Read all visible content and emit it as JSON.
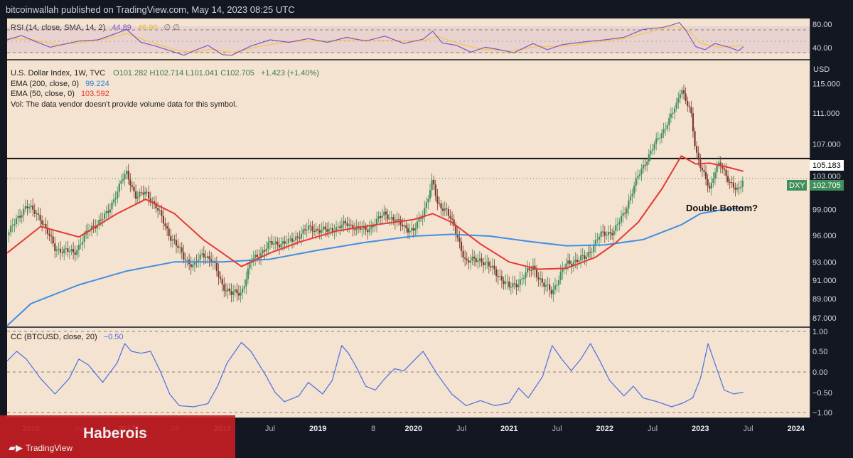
{
  "publisher": "bitcoinwallah published on TradingView.com, May 14, 2023 08:25 UTC",
  "colors": {
    "background": "#f4e3d0",
    "frame": "#131722",
    "up_candle": "#3f8f5b",
    "down_candle": "#7a3a2c",
    "ema200": "#3f8fe3",
    "ema50": "#e53935",
    "rsi_line": "#7e57c2",
    "rsi_sma": "#f2c94c",
    "corr_line": "#4a6fe3",
    "watermark": "#c21e23"
  },
  "rsi_panel": {
    "legend": {
      "name": "RSI (14, close, SMA, 14, 2)",
      "value": "44.89",
      "sma_value": "46.90",
      "extra": "∅  ∅"
    },
    "axis_labels": [
      "80.00",
      "40.00"
    ]
  },
  "main_panel": {
    "legend": {
      "symbol": "U.S. Dollar Index, 1W, TVC",
      "ohlc": "O101.282  H102.714  L101.041  C102.705",
      "change": "+1.423 (+1.40%)",
      "ema200_name": "EMA (200, close, 0)",
      "ema200_value": "99.224",
      "ema50_name": "EMA (50, close, 0)",
      "ema50_value": "103.592",
      "vol": "Vol: The data vendor doesn't provide volume data for this symbol."
    },
    "currency": "USD",
    "resistance_label": "105.183",
    "dxy_badge": {
      "symbol": "DXY",
      "value": "102.705"
    },
    "annotation": "Double Bottom?"
  },
  "cc_panel": {
    "legend": {
      "name": "CC (BTCUSD, close, 20)",
      "value": "−0.50"
    },
    "axis_labels": [
      "1.00",
      "0.50",
      "0.00",
      "−0.50",
      "−1.00"
    ]
  },
  "time_axis": [
    "2016",
    "Jul",
    "2017",
    "Jul",
    "2018",
    "Jul",
    "2019",
    "8",
    "2020",
    "Jul",
    "2021",
    "Jul",
    "2022",
    "Jul",
    "2023",
    "Jul",
    "2024"
  ],
  "watermark": {
    "text": "Haberois",
    "logo_text": "TradingView",
    "logo_icon": "tradingview-logo-icon"
  },
  "chart_data": {
    "type": "candlestick",
    "interval": "1W",
    "x_range": [
      2015.75,
      2024.15
    ],
    "price": {
      "log_scale": true,
      "ylim": [
        86.2,
        117.5
      ],
      "ticks": [
        "87.000",
        "89.000",
        "91.000",
        "93.000",
        "96.000",
        "99.000",
        "103.000",
        "107.000",
        "111.000",
        "115.000"
      ],
      "resistance": 105.183,
      "dxy_path": [
        [
          2015.75,
          96
        ],
        [
          2015.95,
          99.5
        ],
        [
          2016.1,
          98
        ],
        [
          2016.25,
          94.5
        ],
        [
          2016.45,
          94
        ],
        [
          2016.6,
          96.5
        ],
        [
          2016.8,
          98.5
        ],
        [
          2016.95,
          102.5
        ],
        [
          2017.0,
          103.3
        ],
        [
          2017.1,
          100.5
        ],
        [
          2017.2,
          101
        ],
        [
          2017.3,
          99.5
        ],
        [
          2017.45,
          96
        ],
        [
          2017.6,
          93.5
        ],
        [
          2017.7,
          92.5
        ],
        [
          2017.8,
          94
        ],
        [
          2017.9,
          93
        ],
        [
          2018.0,
          90.5
        ],
        [
          2018.1,
          89.5
        ],
        [
          2018.2,
          89.7
        ],
        [
          2018.3,
          93
        ],
        [
          2018.5,
          95
        ],
        [
          2018.7,
          95.2
        ],
        [
          2018.9,
          96.8
        ],
        [
          2019.1,
          96.5
        ],
        [
          2019.3,
          97.3
        ],
        [
          2019.5,
          96.5
        ],
        [
          2019.7,
          98.5
        ],
        [
          2019.9,
          97
        ],
        [
          2020.0,
          96.5
        ],
        [
          2020.1,
          98.5
        ],
        [
          2020.2,
          102.5
        ],
        [
          2020.25,
          99.5
        ],
        [
          2020.35,
          99
        ],
        [
          2020.45,
          96
        ],
        [
          2020.55,
          93
        ],
        [
          2020.7,
          93.3
        ],
        [
          2020.85,
          92
        ],
        [
          2021.0,
          90.2
        ],
        [
          2021.1,
          90.8
        ],
        [
          2021.25,
          92.5
        ],
        [
          2021.35,
          90.5
        ],
        [
          2021.45,
          89.8
        ],
        [
          2021.6,
          92.8
        ],
        [
          2021.8,
          93.5
        ],
        [
          2021.95,
          96
        ],
        [
          2022.1,
          96.5
        ],
        [
          2022.2,
          98.5
        ],
        [
          2022.35,
          103
        ],
        [
          2022.5,
          106.5
        ],
        [
          2022.6,
          108.5
        ],
        [
          2022.75,
          112
        ],
        [
          2022.8,
          114.5
        ],
        [
          2022.9,
          111
        ],
        [
          2022.95,
          106
        ],
        [
          2023.05,
          103
        ],
        [
          2023.1,
          101
        ],
        [
          2023.15,
          103.5
        ],
        [
          2023.2,
          105
        ],
        [
          2023.3,
          102
        ],
        [
          2023.4,
          101.5
        ],
        [
          2023.45,
          102.7
        ]
      ],
      "ema50": [
        [
          2015.75,
          94
        ],
        [
          2016.1,
          97
        ],
        [
          2016.5,
          95.8
        ],
        [
          2016.9,
          98.5
        ],
        [
          2017.2,
          100.2
        ],
        [
          2017.5,
          98.5
        ],
        [
          2017.8,
          95.5
        ],
        [
          2018.0,
          94
        ],
        [
          2018.2,
          92.5
        ],
        [
          2018.5,
          94
        ],
        [
          2018.8,
          95.2
        ],
        [
          2019.2,
          96.5
        ],
        [
          2019.6,
          97.2
        ],
        [
          2020.0,
          97.8
        ],
        [
          2020.2,
          98.5
        ],
        [
          2020.4,
          97.5
        ],
        [
          2020.7,
          95
        ],
        [
          2021.0,
          93
        ],
        [
          2021.3,
          92.2
        ],
        [
          2021.6,
          92.3
        ],
        [
          2021.9,
          93.5
        ],
        [
          2022.1,
          95
        ],
        [
          2022.35,
          97.5
        ],
        [
          2022.6,
          101.5
        ],
        [
          2022.8,
          105.5
        ],
        [
          2022.95,
          104.5
        ],
        [
          2023.1,
          104.6
        ],
        [
          2023.25,
          104.2
        ],
        [
          2023.45,
          103.6
        ]
      ],
      "ema200": [
        [
          2015.75,
          86.2
        ],
        [
          2016.0,
          88.5
        ],
        [
          2016.5,
          90.5
        ],
        [
          2017.0,
          92
        ],
        [
          2017.5,
          93
        ],
        [
          2018.0,
          93
        ],
        [
          2018.5,
          93.3
        ],
        [
          2019.0,
          94.3
        ],
        [
          2019.5,
          95.2
        ],
        [
          2020.0,
          95.9
        ],
        [
          2020.4,
          96.1
        ],
        [
          2020.8,
          95.9
        ],
        [
          2021.2,
          95.3
        ],
        [
          2021.6,
          94.8
        ],
        [
          2022.0,
          94.9
        ],
        [
          2022.4,
          95.5
        ],
        [
          2022.8,
          97.2
        ],
        [
          2023.0,
          98.5
        ],
        [
          2023.2,
          98.9
        ],
        [
          2023.45,
          99.22
        ]
      ]
    },
    "rsi": {
      "ylim": [
        26,
        86
      ],
      "bands": [
        70,
        30
      ],
      "path": [
        [
          2015.75,
          56
        ],
        [
          2015.9,
          63
        ],
        [
          2016.05,
          53
        ],
        [
          2016.2,
          44
        ],
        [
          2016.35,
          49
        ],
        [
          2016.5,
          54
        ],
        [
          2016.7,
          56
        ],
        [
          2016.9,
          67
        ],
        [
          2017.0,
          73
        ],
        [
          2017.15,
          52
        ],
        [
          2017.3,
          46
        ],
        [
          2017.5,
          36
        ],
        [
          2017.6,
          31
        ],
        [
          2017.7,
          38
        ],
        [
          2017.85,
          47
        ],
        [
          2018.0,
          32
        ],
        [
          2018.1,
          31
        ],
        [
          2018.3,
          46
        ],
        [
          2018.5,
          56
        ],
        [
          2018.7,
          52
        ],
        [
          2018.9,
          58
        ],
        [
          2019.1,
          52
        ],
        [
          2019.3,
          60
        ],
        [
          2019.5,
          54
        ],
        [
          2019.7,
          62
        ],
        [
          2019.9,
          50
        ],
        [
          2020.1,
          57
        ],
        [
          2020.2,
          70
        ],
        [
          2020.3,
          51
        ],
        [
          2020.45,
          47
        ],
        [
          2020.6,
          36
        ],
        [
          2020.75,
          44
        ],
        [
          2020.9,
          40
        ],
        [
          2021.05,
          35
        ],
        [
          2021.25,
          50
        ],
        [
          2021.4,
          40
        ],
        [
          2021.55,
          48
        ],
        [
          2021.8,
          53
        ],
        [
          2022.0,
          56
        ],
        [
          2022.2,
          60
        ],
        [
          2022.4,
          73
        ],
        [
          2022.6,
          76
        ],
        [
          2022.7,
          80
        ],
        [
          2022.78,
          84
        ],
        [
          2022.85,
          71
        ],
        [
          2022.95,
          45
        ],
        [
          2023.05,
          40
        ],
        [
          2023.15,
          50
        ],
        [
          2023.3,
          44
        ],
        [
          2023.4,
          38
        ],
        [
          2023.45,
          44.89
        ]
      ],
      "sma": [
        [
          2015.75,
          58
        ],
        [
          2016.0,
          57
        ],
        [
          2016.25,
          48
        ],
        [
          2016.5,
          51
        ],
        [
          2016.8,
          58
        ],
        [
          2017.0,
          66
        ],
        [
          2017.2,
          55
        ],
        [
          2017.5,
          40
        ],
        [
          2017.7,
          36
        ],
        [
          2017.9,
          41
        ],
        [
          2018.1,
          35
        ],
        [
          2018.4,
          46
        ],
        [
          2018.7,
          53
        ],
        [
          2019.0,
          54
        ],
        [
          2019.4,
          56
        ],
        [
          2019.8,
          55
        ],
        [
          2020.1,
          54
        ],
        [
          2020.25,
          62
        ],
        [
          2020.45,
          51
        ],
        [
          2020.7,
          41
        ],
        [
          2021.0,
          38
        ],
        [
          2021.3,
          45
        ],
        [
          2021.6,
          46
        ],
        [
          2021.9,
          52
        ],
        [
          2022.2,
          58
        ],
        [
          2022.5,
          70
        ],
        [
          2022.75,
          79
        ],
        [
          2022.9,
          68
        ],
        [
          2023.0,
          50
        ],
        [
          2023.2,
          44
        ],
        [
          2023.45,
          46.9
        ]
      ]
    },
    "cc": {
      "ylim": [
        -1.1,
        1.1
      ],
      "path": [
        [
          2015.75,
          0.3
        ],
        [
          2015.85,
          0.55
        ],
        [
          2015.95,
          0.35
        ],
        [
          2016.1,
          -0.15
        ],
        [
          2016.25,
          -0.55
        ],
        [
          2016.4,
          -0.15
        ],
        [
          2016.5,
          0.35
        ],
        [
          2016.6,
          0.2
        ],
        [
          2016.75,
          -0.25
        ],
        [
          2016.9,
          0.25
        ],
        [
          2016.98,
          0.75
        ],
        [
          2017.05,
          0.55
        ],
        [
          2017.15,
          0.5
        ],
        [
          2017.25,
          0.55
        ],
        [
          2017.35,
          0.05
        ],
        [
          2017.45,
          -0.55
        ],
        [
          2017.55,
          -0.85
        ],
        [
          2017.7,
          -0.88
        ],
        [
          2017.85,
          -0.8
        ],
        [
          2017.95,
          -0.35
        ],
        [
          2018.05,
          0.25
        ],
        [
          2018.2,
          0.78
        ],
        [
          2018.3,
          0.55
        ],
        [
          2018.45,
          -0.05
        ],
        [
          2018.55,
          -0.5
        ],
        [
          2018.65,
          -0.75
        ],
        [
          2018.8,
          -0.6
        ],
        [
          2018.9,
          -0.25
        ],
        [
          2019.05,
          -0.55
        ],
        [
          2019.15,
          -0.2
        ],
        [
          2019.25,
          0.7
        ],
        [
          2019.32,
          0.5
        ],
        [
          2019.4,
          0.15
        ],
        [
          2019.5,
          -0.35
        ],
        [
          2019.6,
          -0.45
        ],
        [
          2019.7,
          -0.15
        ],
        [
          2019.8,
          0.1
        ],
        [
          2019.9,
          0.05
        ],
        [
          2020.0,
          0.3
        ],
        [
          2020.1,
          0.55
        ],
        [
          2020.15,
          0.35
        ],
        [
          2020.25,
          -0.05
        ],
        [
          2020.4,
          -0.55
        ],
        [
          2020.55,
          -0.85
        ],
        [
          2020.7,
          -0.72
        ],
        [
          2020.85,
          -0.85
        ],
        [
          2021.0,
          -0.78
        ],
        [
          2021.1,
          -0.4
        ],
        [
          2021.2,
          -0.65
        ],
        [
          2021.35,
          -0.1
        ],
        [
          2021.45,
          0.7
        ],
        [
          2021.55,
          0.35
        ],
        [
          2021.65,
          0.05
        ],
        [
          2021.75,
          0.35
        ],
        [
          2021.85,
          0.75
        ],
        [
          2021.95,
          0.3
        ],
        [
          2022.05,
          -0.2
        ],
        [
          2022.2,
          -0.6
        ],
        [
          2022.3,
          -0.35
        ],
        [
          2022.4,
          -0.65
        ],
        [
          2022.55,
          -0.75
        ],
        [
          2022.7,
          -0.88
        ],
        [
          2022.82,
          -0.78
        ],
        [
          2022.92,
          -0.65
        ],
        [
          2023.0,
          -0.15
        ],
        [
          2023.08,
          0.75
        ],
        [
          2023.15,
          0.25
        ],
        [
          2023.25,
          -0.45
        ],
        [
          2023.35,
          -0.55
        ],
        [
          2023.45,
          -0.5
        ]
      ]
    }
  }
}
